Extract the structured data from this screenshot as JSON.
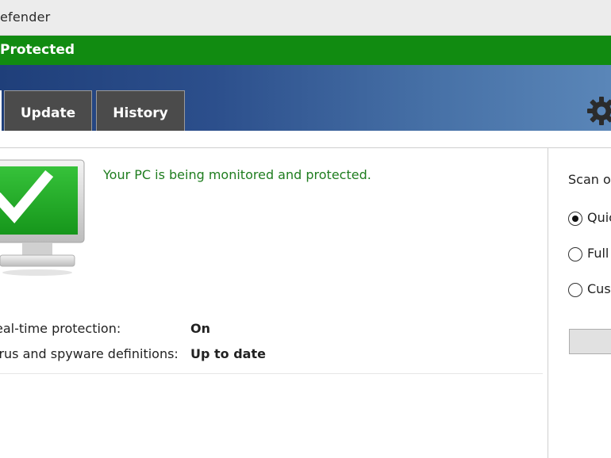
{
  "window": {
    "title": "efender"
  },
  "status": {
    "text": "Protected",
    "color": "#118b11"
  },
  "tabs": [
    {
      "label": "Update"
    },
    {
      "label": "History"
    }
  ],
  "main": {
    "headline": "Your PC is being monitored and protected.",
    "rows": [
      {
        "label": "eal-time protection:",
        "value": "On"
      },
      {
        "label": "irus and spyware definitions:",
        "value": "Up to date"
      }
    ]
  },
  "scan": {
    "title": "Scan op",
    "options": [
      {
        "label": "Quic",
        "selected": true
      },
      {
        "label": "Full",
        "selected": false
      },
      {
        "label": "Cust",
        "selected": false
      }
    ]
  },
  "icons": {
    "monitor": "monitor-check-icon",
    "settings": "gear-icon"
  }
}
